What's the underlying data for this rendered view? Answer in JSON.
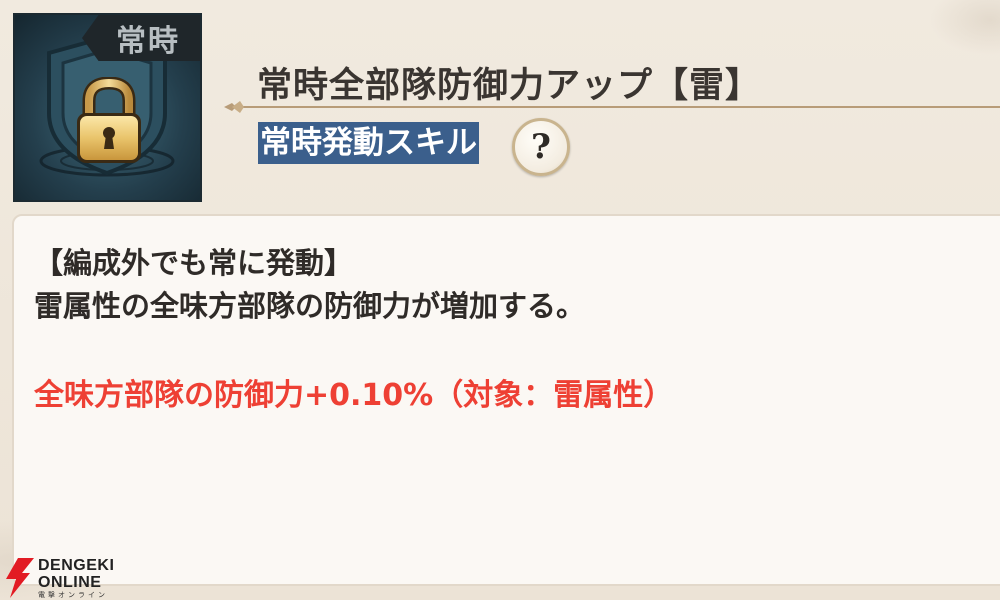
{
  "skill": {
    "icon_tag": "常時",
    "icon_name": "lock-icon",
    "title": "常時全部隊防御力アップ【雷】",
    "type_label": "常時発動スキル",
    "help_label": "?"
  },
  "description": {
    "line1": "【編成外でも常に発動】",
    "line2": "雷属性の全味方部隊の防御力が増加する。",
    "effect": "全味方部隊の防御力+0.10%（対象：雷属性）"
  },
  "watermark": {
    "line1": "DENGEKI",
    "line2": "ONLINE",
    "line3": "電撃オンライン"
  },
  "colors": {
    "effect_text": "#ee4034",
    "type_label_bg": "#3b5f8c",
    "panel_bg": "#fbf8f4",
    "page_bg": "#efe7dc"
  }
}
